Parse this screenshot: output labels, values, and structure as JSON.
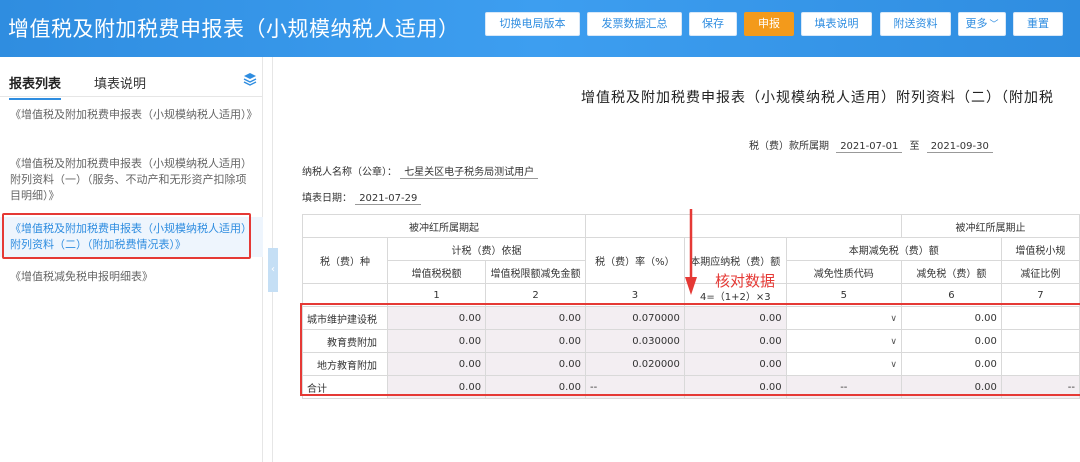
{
  "app": {
    "title": "增值税及附加税费申报表（小规模纳税人适用）"
  },
  "toolbar": {
    "buttons": [
      {
        "label": "切换电局版本"
      },
      {
        "label": "发票数据汇总"
      },
      {
        "label": "保存"
      },
      {
        "label": "申报"
      },
      {
        "label": "填表说明"
      },
      {
        "label": "附送资料"
      },
      {
        "label": "更多"
      },
      {
        "label": "重置"
      }
    ]
  },
  "sidebar": {
    "tabs": [
      {
        "label": "报表列表"
      },
      {
        "label": "填表说明"
      }
    ],
    "items": [
      {
        "label": "《增值税及附加税费申报表（小规模纳税人适用）》"
      },
      {
        "label": "《增值税及附加税费申报表（小规模纳税人适用）附列资料（一）（服务、不动产和无形资产扣除项目明细）》"
      },
      {
        "label": "《增值税及附加税费申报表（小规模纳税人适用）附列资料（二）（附加税费情况表）》"
      },
      {
        "label": "《增值税减免税申报明细表》"
      }
    ]
  },
  "document": {
    "title": "增值税及附加税费申报表（小规模纳税人适用）附列资料（二）（附加税",
    "period_label": "税（费）款所属期",
    "period_from": "2021-07-01",
    "period_to_label": "至",
    "period_to": "2021-09-30",
    "taxpayer_label": "纳税人名称（公章）：",
    "taxpayer_name": "七星关区电子税务局测试用户",
    "fill_date_label": "填表日期：",
    "fill_date": "2021-07-29"
  },
  "table": {
    "h_start": "被冲红所属期起",
    "h_end": "被冲红所属期止",
    "h_tax_type": "税（费）种",
    "h_basis": "计税（费）依据",
    "h_vat": "增值税税额",
    "h_vat_limit": "增值税限额减免金额",
    "h_rate": "税（费）率（%）",
    "h_payable": "本期应纳税（费）额",
    "h_relief": "本期减免税（费）额",
    "h_relief_code": "减免性质代码",
    "h_relief_amt": "减免税（费）额",
    "h_small": "增值税小规",
    "h_small_sub": "减征比例",
    "col_nums": [
      "1",
      "2",
      "3",
      "4=（1+2）×3",
      "5",
      "6",
      "7"
    ],
    "rows": [
      {
        "name": "城市维护建设税",
        "vat": "0.00",
        "limit": "0.00",
        "rate": "0.070000",
        "payable": "0.00",
        "code": "",
        "relief": "0.00"
      },
      {
        "name": "教育费附加",
        "vat": "0.00",
        "limit": "0.00",
        "rate": "0.030000",
        "payable": "0.00",
        "code": "",
        "relief": "0.00"
      },
      {
        "name": "地方教育附加",
        "vat": "0.00",
        "limit": "0.00",
        "rate": "0.020000",
        "payable": "0.00",
        "code": "",
        "relief": "0.00"
      }
    ],
    "total": {
      "name": "合计",
      "vat": "0.00",
      "limit": "0.00",
      "rate": "--",
      "payable": "0.00",
      "code": "--",
      "relief": "0.00",
      "small": "--"
    }
  },
  "annotation": {
    "text": "核对数据"
  },
  "colors": {
    "header_blue": "#2f8de0",
    "primary_orange": "#f39a1b",
    "highlight_red": "#e53935"
  }
}
